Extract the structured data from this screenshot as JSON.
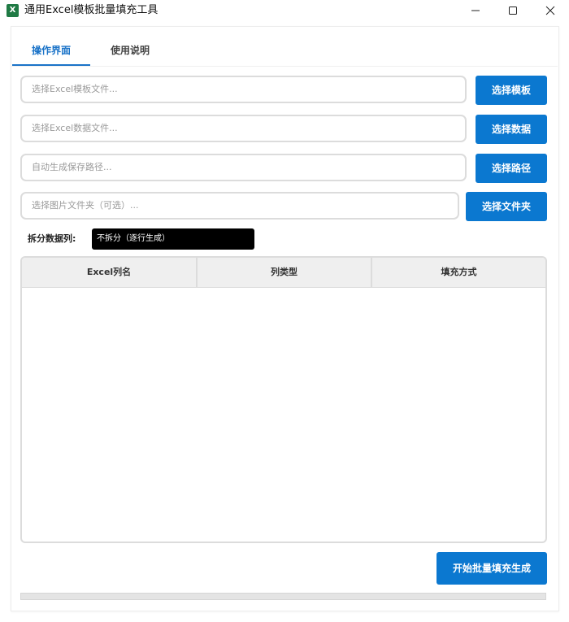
{
  "window": {
    "icon_letter": "X",
    "title": "通用Excel模板批量填充工具"
  },
  "tabs": [
    {
      "label": "操作界面",
      "active": true
    },
    {
      "label": "使用说明",
      "active": false
    }
  ],
  "inputs": {
    "template": {
      "placeholder": "选择Excel模板文件...",
      "value": "",
      "button": "选择模板"
    },
    "data": {
      "placeholder": "选择Excel数据文件...",
      "value": "",
      "button": "选择数据"
    },
    "save_path": {
      "placeholder": "自动生成保存路径...",
      "value": "",
      "button": "选择路径"
    },
    "image_folder": {
      "placeholder": "选择图片文件夹（可选）...",
      "value": "",
      "button": "选择文件夹"
    }
  },
  "split": {
    "label": "拆分数据列:",
    "selected": "不拆分（逐行生成）"
  },
  "table": {
    "columns": [
      "Excel列名",
      "列类型",
      "填充方式"
    ],
    "rows": []
  },
  "actions": {
    "start_button": "开始批量填充生成"
  },
  "progress": {
    "value": 0
  },
  "colors": {
    "accent": "#0b78d0",
    "excel_icon": "#1f7a44"
  }
}
